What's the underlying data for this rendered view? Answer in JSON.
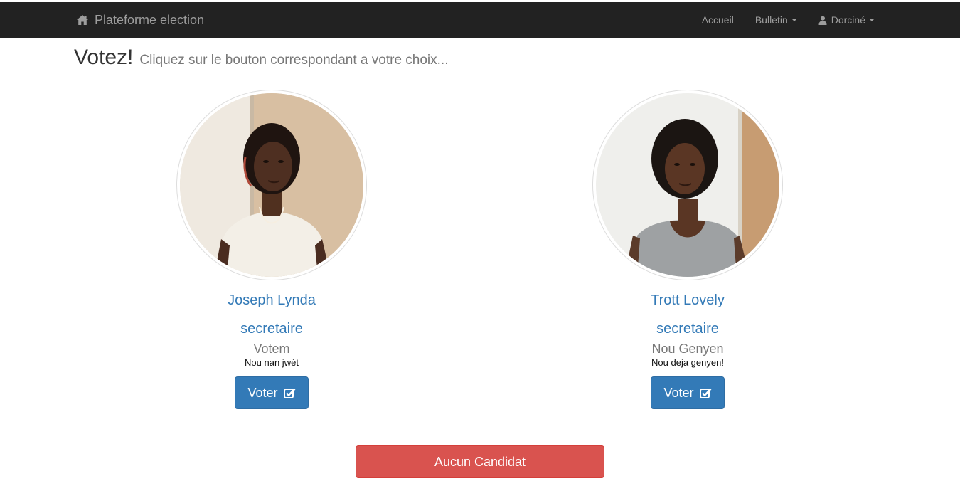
{
  "navbar": {
    "brand_icon": "home-icon",
    "brand": "Plateforme election",
    "links": {
      "home": "Accueil",
      "ballot": "Bulletin",
      "user": "Dorciné"
    },
    "user_icon": "user-icon"
  },
  "header": {
    "title": "Votez!",
    "subtitle": "Cliquez sur le bouton correspondant a votre choix..."
  },
  "candidates": [
    {
      "name": "Joseph Lynda",
      "position": "secretaire",
      "party": "Votem",
      "slogan": "Nou nan jwèt",
      "vote_label": "Voter",
      "vote_icon": "check-square-icon"
    },
    {
      "name": "Trott Lovely",
      "position": "secretaire",
      "party": "Nou Genyen",
      "slogan": "Nou deja genyen!",
      "vote_label": "Voter",
      "vote_icon": "check-square-icon"
    }
  ],
  "none_button": "Aucun Candidat",
  "colors": {
    "navbar_bg": "#222222",
    "navbar_text": "#9d9d9d",
    "primary": "#337ab7",
    "danger": "#d9534f",
    "muted": "#777777"
  }
}
